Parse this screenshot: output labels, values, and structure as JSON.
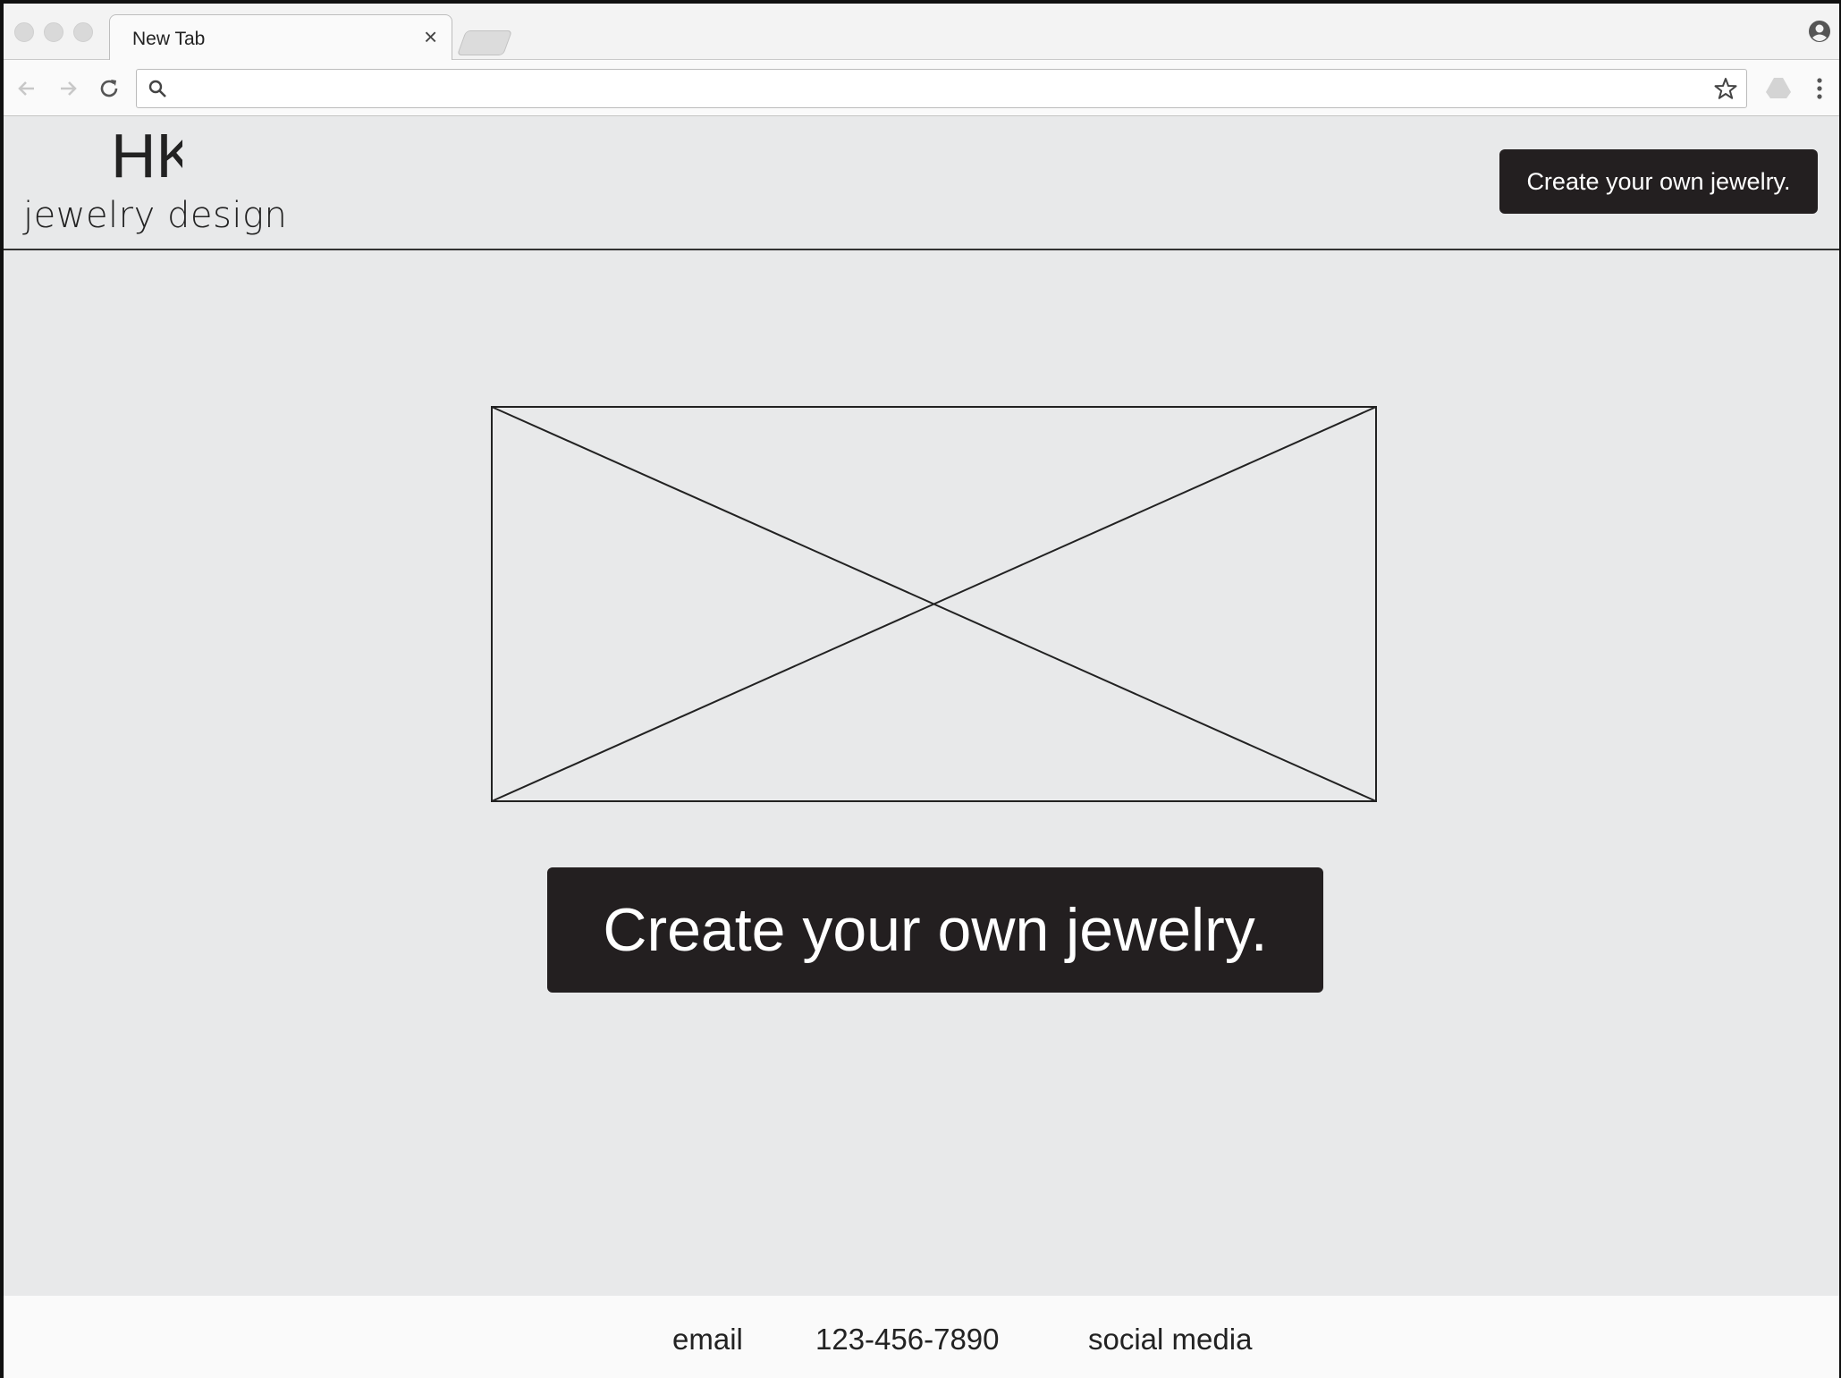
{
  "browser": {
    "tab_title": "New Tab",
    "tab_close_glyph": "×",
    "address_value": "",
    "address_placeholder": "",
    "icons": [
      "close-icon",
      "back-arrow-icon",
      "forward-arrow-icon",
      "reload-icon",
      "search-icon",
      "star-icon",
      "drive-icon",
      "menu-dots-icon",
      "profile-icon"
    ]
  },
  "header": {
    "logo_mark": "HK",
    "logo_text": "jewelry design",
    "cta_label": "Create your own jewelry."
  },
  "hero": {
    "image_placeholder": "image-placeholder",
    "cta_label": "Create your own jewelry."
  },
  "footer": {
    "email": "email",
    "phone": "123-456-7890",
    "social": "social media"
  },
  "colors": {
    "page_background": "#e8e9ea",
    "button_background": "#231f20",
    "button_text": "#ffffff",
    "footer_background": "#fafafa"
  }
}
